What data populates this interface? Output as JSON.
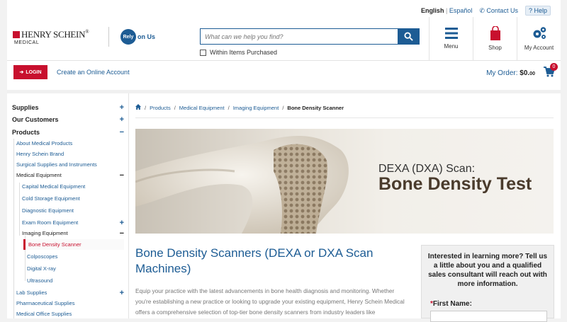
{
  "util": {
    "lang_en": "English",
    "lang_sep": "|",
    "lang_es": "Español",
    "contact": "Contact Us",
    "help": "Help"
  },
  "header": {
    "logo_main": "HENRY SCHEIN",
    "logo_reg": "®",
    "logo_sub": "MEDICAL",
    "rely_circle": "Rely",
    "rely_text": "on Us",
    "search_placeholder": "What can we help you find?",
    "within_label": "Within Items Purchased",
    "menu_label": "Menu",
    "shop_label": "Shop",
    "account_label": "My Account"
  },
  "subbar": {
    "login": "LOGIN",
    "create": "Create an Online Account",
    "order_label": "My Order:",
    "order_amount": "$0.",
    "order_cents": "00",
    "cart_count": "0"
  },
  "sidebar": {
    "items": [
      {
        "label": "Supplies",
        "sign": "+"
      },
      {
        "label": "Our Customers",
        "sign": "+"
      },
      {
        "label": "Products",
        "sign": "−"
      },
      {
        "label": "About Medical Products",
        "sign": ""
      },
      {
        "label": "Henry Schein Brand",
        "sign": ""
      },
      {
        "label": "Surgical Supplies and Instruments",
        "sign": ""
      },
      {
        "label": "Medical Equipment",
        "sign": "−"
      },
      {
        "label": "Capital Medical Equipment",
        "sign": ""
      },
      {
        "label": "Cold Storage Equipment",
        "sign": ""
      },
      {
        "label": "Diagnostic Equipment",
        "sign": ""
      },
      {
        "label": "Exam Room Equipment",
        "sign": "+"
      },
      {
        "label": "Imaging Equipment",
        "sign": "−"
      },
      {
        "label": "Bone Density Scanner",
        "sign": ""
      },
      {
        "label": "Colposcopes",
        "sign": ""
      },
      {
        "label": "Digital X-ray",
        "sign": ""
      },
      {
        "label": "Ultrasound",
        "sign": ""
      },
      {
        "label": "Lab Supplies",
        "sign": "+"
      },
      {
        "label": "Pharmaceutical Supplies",
        "sign": ""
      },
      {
        "label": "Medical Office Supplies",
        "sign": ""
      }
    ]
  },
  "breadcrumb": {
    "items": [
      "Products",
      "Medical Equipment",
      "Imaging Equipment"
    ],
    "current": "Bone Density Scanner",
    "sep": "/"
  },
  "banner": {
    "line1": "DEXA (DXA) Scan:",
    "line2": "Bone Density Test"
  },
  "main": {
    "title": "Bone Density Scanners (DEXA or DXA Scan Machines)",
    "body": "Equip your practice with the latest advancements in bone health diagnosis and monitoring. Whether you're establishing a new practice or looking to upgrade your existing equipment, Henry Schein Medical offers a comprehensive selection of top-tier bone density scanners from industry leaders like"
  },
  "form": {
    "title": "Interested in learning more? Tell us a little about you and a qualified sales consultant will reach out with more information.",
    "required_mark": "*",
    "first_name_label": "First Name:"
  },
  "colors": {
    "brand_blue": "#1d5c94",
    "brand_red": "#c8102e"
  }
}
